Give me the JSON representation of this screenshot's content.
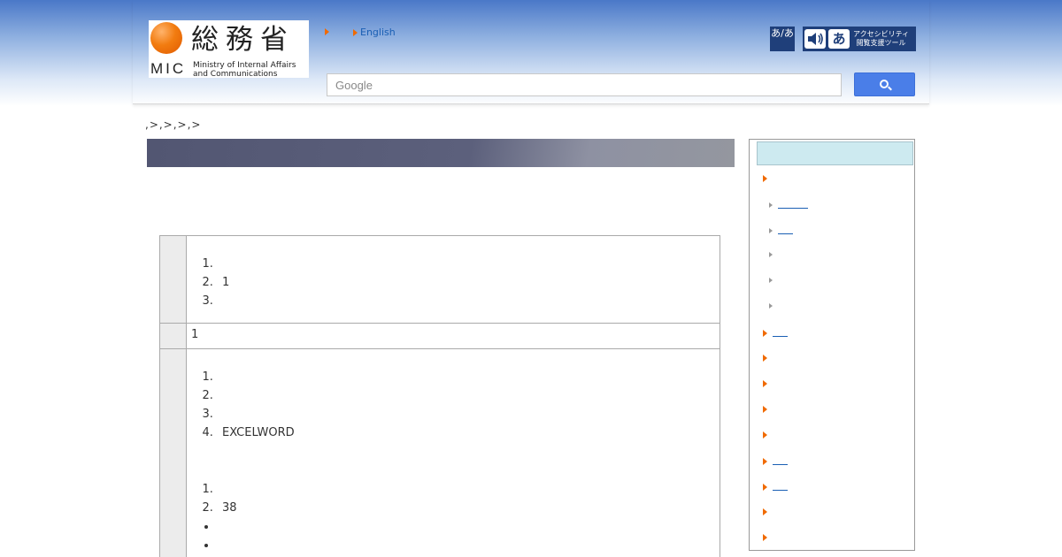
{
  "header": {
    "logo": {
      "kanji": "総務省",
      "abbr": "MIC",
      "english_line1": "Ministry of Internal Affairs",
      "english_line2": "and Communications"
    },
    "english_link": "English",
    "a11y_font_label": "あ/あ",
    "a11y_tool_label_line1": "アクセシビリティ",
    "a11y_tool_label_line2": "閲覧支援ツール",
    "a11y_tool_glyph": "あ",
    "search": {
      "placeholder": "Google",
      "button_icon": "search-icon"
    }
  },
  "breadcrumb": ",>,>,>,>",
  "content": {
    "row1": {
      "items": [
        "",
        "1",
        ""
      ]
    },
    "row2": {
      "text": "1"
    },
    "row3": {
      "list_a": [
        "",
        "",
        "",
        "EXCELWORD"
      ],
      "list_b": [
        "",
        "38"
      ],
      "bullets": [
        "",
        ""
      ]
    }
  },
  "colors": {
    "accent_orange": "#f06a00",
    "link_blue": "#1a5fb4",
    "sidebar_header": "#cdeaf0",
    "search_button": "#4a7ee8"
  }
}
